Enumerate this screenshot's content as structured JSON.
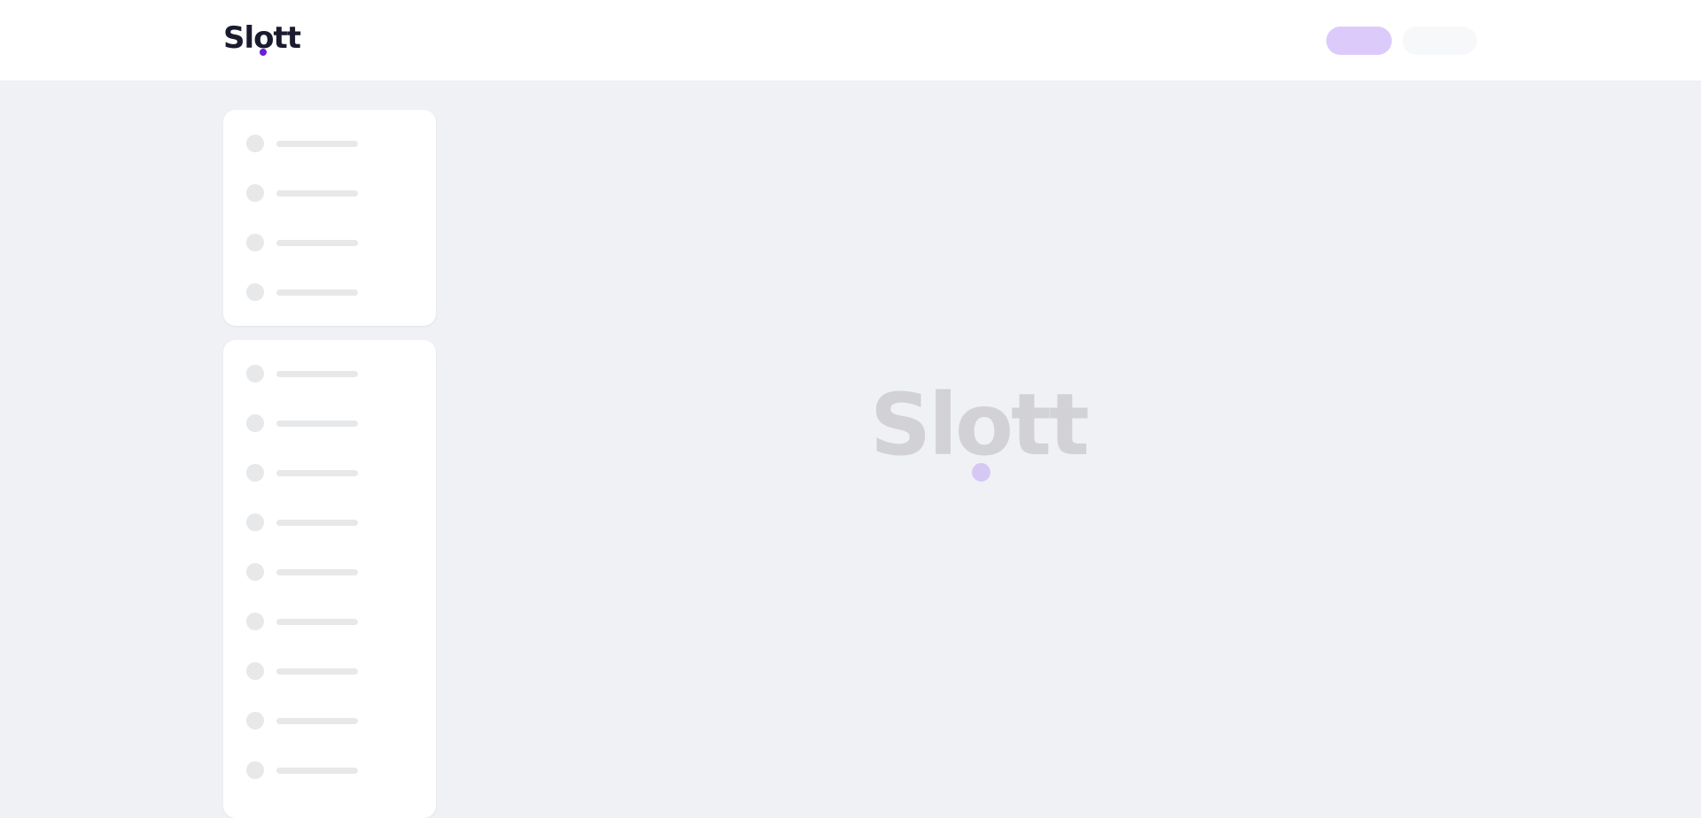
{
  "header": {
    "brand": "Slott",
    "brand_accent": "#6a1fdb"
  },
  "loader": {
    "logo_text": "Slott",
    "text_color": "#d2d2d6",
    "dot_color": "#d6c8f4"
  },
  "header_actions": [
    {
      "kind": "primary-placeholder",
      "color": "#dccbfa"
    },
    {
      "kind": "secondary-placeholder",
      "color": "#f7f8fa"
    }
  ],
  "sidebar": {
    "groups": [
      {
        "items": 4
      },
      {
        "items": 9
      }
    ],
    "skeleton_color": "#e7e8ea"
  },
  "colors": {
    "page_background": "#f0f1f5",
    "card_background": "#ffffff"
  }
}
